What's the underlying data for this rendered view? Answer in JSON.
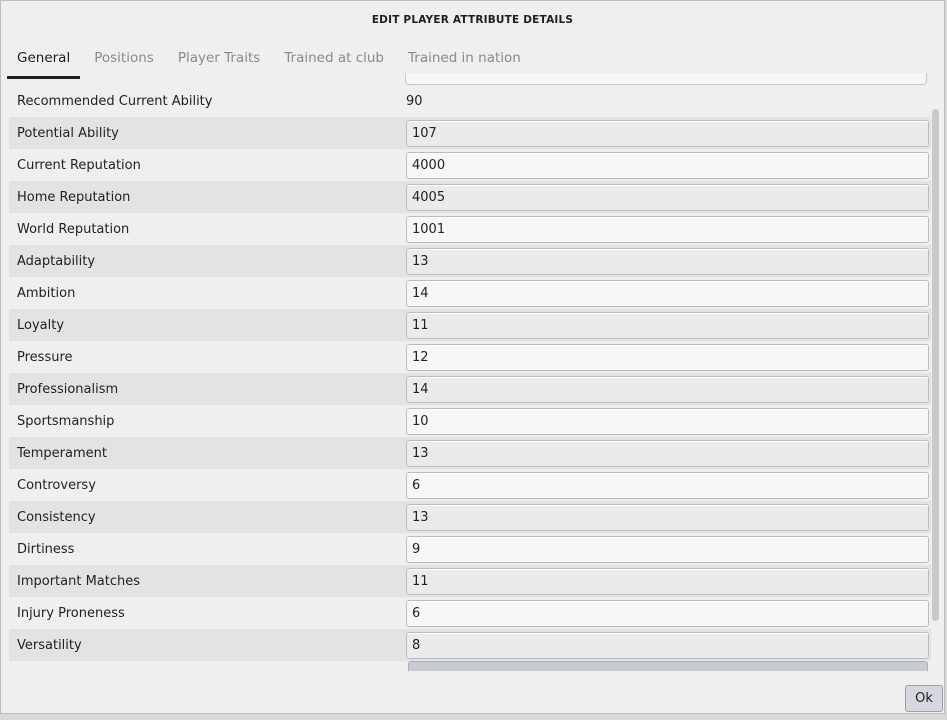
{
  "dialog": {
    "title": "EDIT PLAYER ATTRIBUTE DETAILS"
  },
  "tabs": [
    {
      "label": "General"
    },
    {
      "label": "Positions"
    },
    {
      "label": "Player Traits"
    },
    {
      "label": "Trained at club"
    },
    {
      "label": "Trained in nation"
    }
  ],
  "active_tab": "General",
  "recommended": {
    "label": "Recommended Current Ability",
    "value": "90"
  },
  "fields": [
    {
      "label": "Potential Ability",
      "value": "107"
    },
    {
      "label": "Current Reputation",
      "value": "4000"
    },
    {
      "label": "Home Reputation",
      "value": "4005"
    },
    {
      "label": "World Reputation",
      "value": "1001"
    },
    {
      "label": "Adaptability",
      "value": "13"
    },
    {
      "label": "Ambition",
      "value": "14"
    },
    {
      "label": "Loyalty",
      "value": "11"
    },
    {
      "label": "Pressure",
      "value": "12"
    },
    {
      "label": "Professionalism",
      "value": "14"
    },
    {
      "label": "Sportsmanship",
      "value": "10"
    },
    {
      "label": "Temperament",
      "value": "13"
    },
    {
      "label": "Controversy",
      "value": "6"
    },
    {
      "label": "Consistency",
      "value": "13"
    },
    {
      "label": "Dirtiness",
      "value": "9"
    },
    {
      "label": "Important Matches",
      "value": "11"
    },
    {
      "label": "Injury Proneness",
      "value": "6"
    },
    {
      "label": "Versatility",
      "value": "8"
    }
  ],
  "footer": {
    "ok_label": "Ok"
  }
}
